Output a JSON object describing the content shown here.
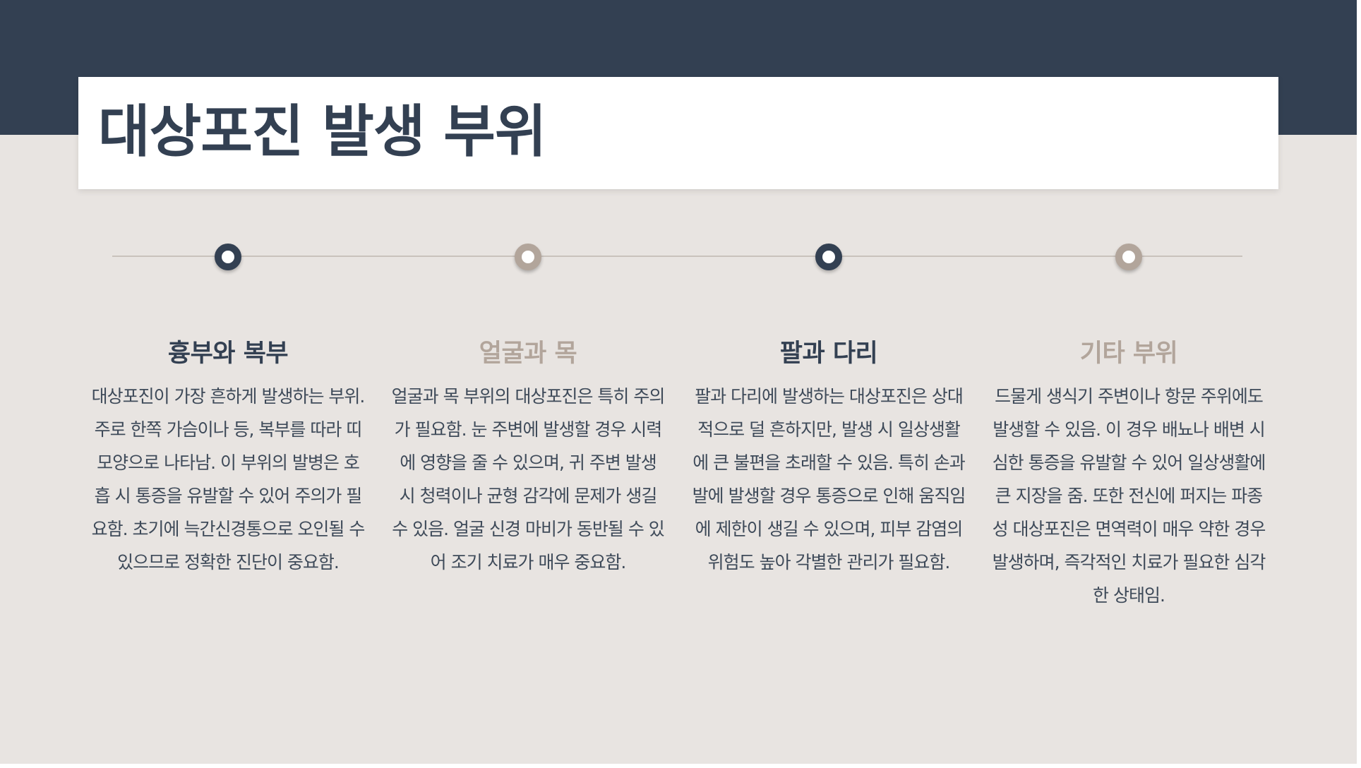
{
  "title": "대상포진 발생 부위",
  "items": [
    {
      "title": "흉부와 복부",
      "body": "대상포진이 가장 흔하게 발생하는 부위. 주로 한쪽 가슴이나 등, 복부를 따라 띠 모양으로 나타남. 이 부위의 발병은 호흡 시 통증을 유발할 수 있어 주의가 필요함. 초기에 늑간신경통으로 오인될 수 있으므로 정확한 진단이 중요함.",
      "accent": "#334052"
    },
    {
      "title": "얼굴과 목",
      "body": "얼굴과 목 부위의 대상포진은 특히 주의가 필요함. 눈 주변에 발생할 경우 시력에 영향을 줄 수 있으며, 귀 주변 발생 시 청력이나 균형 감각에 문제가 생길 수 있음. 얼굴 신경 마비가 동반될 수 있어 조기 치료가 매우 중요함.",
      "accent": "#b2a59b"
    },
    {
      "title": "팔과 다리",
      "body": "팔과 다리에 발생하는 대상포진은 상대적으로 덜 흔하지만, 발생 시 일상생활에 큰 불편을 초래할 수 있음. 특히 손과 발에 발생할 경우 통증으로 인해 움직임에 제한이 생길 수 있으며, 피부 감염의 위험도 높아 각별한 관리가 필요함.",
      "accent": "#334052"
    },
    {
      "title": "기타 부위",
      "body": "드물게 생식기 주변이나 항문 주위에도 발생할 수 있음. 이 경우 배뇨나 배변 시 심한 통증을 유발할 수 있어 일상생활에 큰 지장을 줌. 또한 전신에 퍼지는 파종성 대상포진은 면역력이 매우 약한 경우 발생하며, 즉각적인 치료가 필요한 심각한 상태임.",
      "accent": "#b2a59b"
    }
  ]
}
